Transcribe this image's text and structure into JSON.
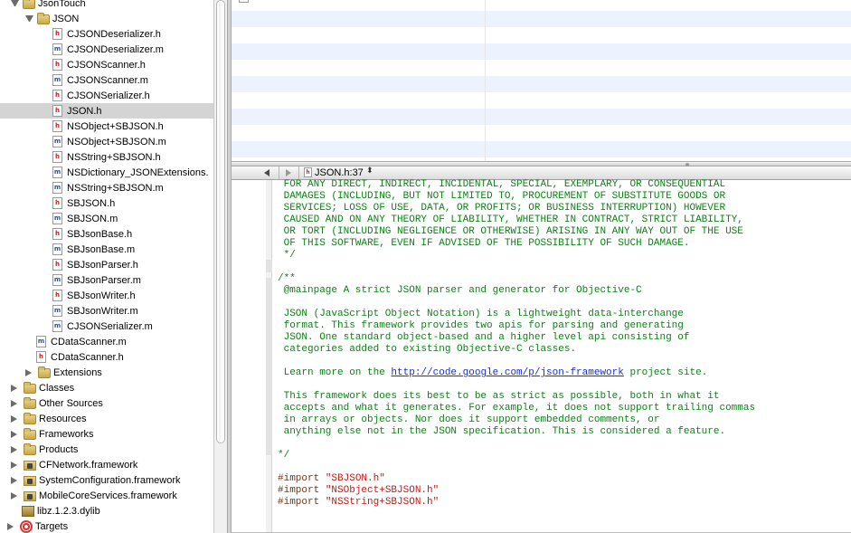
{
  "tree": {
    "rows": [
      {
        "label": "JsonTouch",
        "icon": "folder-icon",
        "disclosure": "open",
        "indent": 1
      },
      {
        "label": "JSON",
        "icon": "folder-icon",
        "disclosure": "open",
        "indent": 2
      },
      {
        "label": "CJSONDeserializer.h",
        "icon": "header-file-icon",
        "disclosure": "none",
        "indent": 3
      },
      {
        "label": "CJSONDeserializer.m",
        "icon": "source-file-icon",
        "disclosure": "none",
        "indent": 3
      },
      {
        "label": "CJSONScanner.h",
        "icon": "header-file-icon",
        "disclosure": "none",
        "indent": 3
      },
      {
        "label": "CJSONScanner.m",
        "icon": "source-file-icon",
        "disclosure": "none",
        "indent": 3
      },
      {
        "label": "CJSONSerializer.h",
        "icon": "header-file-icon",
        "disclosure": "none",
        "indent": 3
      },
      {
        "label": "JSON.h",
        "icon": "header-file-icon",
        "disclosure": "none",
        "indent": 3,
        "selected": true
      },
      {
        "label": "NSObject+SBJSON.h",
        "icon": "header-file-icon",
        "disclosure": "none",
        "indent": 3
      },
      {
        "label": "NSObject+SBJSON.m",
        "icon": "source-file-icon",
        "disclosure": "none",
        "indent": 3
      },
      {
        "label": "NSString+SBJSON.h",
        "icon": "header-file-icon",
        "disclosure": "none",
        "indent": 3
      },
      {
        "label": "NSDictionary_JSONExtensions.",
        "icon": "source-file-icon",
        "disclosure": "none",
        "indent": 3
      },
      {
        "label": "NSString+SBJSON.m",
        "icon": "source-file-icon",
        "disclosure": "none",
        "indent": 3
      },
      {
        "label": "SBJSON.h",
        "icon": "header-file-icon",
        "disclosure": "none",
        "indent": 3
      },
      {
        "label": "SBJSON.m",
        "icon": "source-file-icon",
        "disclosure": "none",
        "indent": 3
      },
      {
        "label": "SBJsonBase.h",
        "icon": "header-file-icon",
        "disclosure": "none",
        "indent": 3
      },
      {
        "label": "SBJsonBase.m",
        "icon": "source-file-icon",
        "disclosure": "none",
        "indent": 3
      },
      {
        "label": "SBJsonParser.h",
        "icon": "header-file-icon",
        "disclosure": "none",
        "indent": 3
      },
      {
        "label": "SBJsonParser.m",
        "icon": "source-file-icon",
        "disclosure": "none",
        "indent": 3
      },
      {
        "label": "SBJsonWriter.h",
        "icon": "header-file-icon",
        "disclosure": "none",
        "indent": 3
      },
      {
        "label": "SBJsonWriter.m",
        "icon": "source-file-icon",
        "disclosure": "none",
        "indent": 3
      },
      {
        "label": "CJSONSerializer.m",
        "icon": "source-file-icon",
        "disclosure": "none",
        "indent": 3
      },
      {
        "label": "CDataScanner.m",
        "icon": "source-file-icon",
        "disclosure": "none",
        "indent": 2
      },
      {
        "label": "CDataScanner.h",
        "icon": "header-file-icon",
        "disclosure": "none",
        "indent": 2
      },
      {
        "label": "Extensions",
        "icon": "folder-icon",
        "disclosure": "closed",
        "indent": 2
      },
      {
        "label": "Classes",
        "icon": "folder-icon",
        "disclosure": "closed",
        "indent": 1
      },
      {
        "label": "Other Sources",
        "icon": "folder-icon",
        "disclosure": "closed",
        "indent": 1
      },
      {
        "label": "Resources",
        "icon": "folder-icon",
        "disclosure": "closed",
        "indent": 1
      },
      {
        "label": "Frameworks",
        "icon": "folder-icon",
        "disclosure": "closed",
        "indent": 1
      },
      {
        "label": "Products",
        "icon": "folder-icon",
        "disclosure": "closed",
        "indent": 1
      },
      {
        "label": "CFNetwork.framework",
        "icon": "framework-icon",
        "disclosure": "closed",
        "indent": 1
      },
      {
        "label": "SystemConfiguration.framework",
        "icon": "framework-icon",
        "disclosure": "closed",
        "indent": 1
      },
      {
        "label": "MobileCoreServices.framework",
        "icon": "framework-icon",
        "disclosure": "closed",
        "indent": 1
      },
      {
        "label": "libz.1.2.3.dylib",
        "icon": "dylib-icon",
        "disclosure": "none",
        "indent": 1
      },
      {
        "label": "Targets",
        "icon": "target-icon",
        "disclosure": "closed",
        "indent": 0
      }
    ]
  },
  "detail": {
    "file_name": "JSON.h"
  },
  "navbar": {
    "file_label": "JSON.h:37",
    "popup_glyph": "⬍"
  },
  "editor": {
    "lines": [
      {
        "text": "FOR ANY DIRECT, INDIRECT, INCIDENTAL, SPECIAL, EXEMPLARY, OR CONSEQUENTIAL",
        "kind": "comment",
        "indent": 1
      },
      {
        "text": "DAMAGES (INCLUDING, BUT NOT LIMITED TO, PROCUREMENT OF SUBSTITUTE GOODS OR",
        "kind": "comment",
        "indent": 1
      },
      {
        "text": "SERVICES; LOSS OF USE, DATA, OR PROFITS; OR BUSINESS INTERRUPTION) HOWEVER",
        "kind": "comment",
        "indent": 1
      },
      {
        "text": "CAUSED AND ON ANY THEORY OF LIABILITY, WHETHER IN CONTRACT, STRICT LIABILITY,",
        "kind": "comment",
        "indent": 1
      },
      {
        "text": "OR TORT (INCLUDING NEGLIGENCE OR OTHERWISE) ARISING IN ANY WAY OUT OF THE USE",
        "kind": "comment",
        "indent": 1
      },
      {
        "text": "OF THIS SOFTWARE, EVEN IF ADVISED OF THE POSSIBILITY OF SUCH DAMAGE.",
        "kind": "comment",
        "indent": 1
      },
      {
        "text": "*/",
        "kind": "comment",
        "indent": 1
      },
      {
        "text": "",
        "kind": "blank",
        "indent": 0
      },
      {
        "text": "/**",
        "kind": "comment",
        "indent": 0
      },
      {
        "text": "@mainpage A strict JSON parser and generator for Objective-C",
        "kind": "comment",
        "indent": 1
      },
      {
        "text": "",
        "kind": "blank",
        "indent": 0
      },
      {
        "text": "JSON (JavaScript Object Notation) is a lightweight data-interchange",
        "kind": "comment",
        "indent": 1
      },
      {
        "text": "format. This framework provides two apis for parsing and generating",
        "kind": "comment",
        "indent": 1
      },
      {
        "text": "JSON. One standard object-based and a higher level api consisting of",
        "kind": "comment",
        "indent": 1
      },
      {
        "text": "categories added to existing Objective-C classes.",
        "kind": "comment",
        "indent": 1
      },
      {
        "text": "",
        "kind": "blank",
        "indent": 0
      },
      {
        "text": "Learn more on the ",
        "kind": "comment-link",
        "indent": 1,
        "link": "http://code.google.com/p/json-framework",
        "after": " project site."
      },
      {
        "text": "",
        "kind": "blank",
        "indent": 0
      },
      {
        "text": "This framework does its best to be as strict as possible, both in what it",
        "kind": "comment",
        "indent": 1
      },
      {
        "text": "accepts and what it generates. For example, it does not support trailing commas",
        "kind": "comment",
        "indent": 1
      },
      {
        "text": "in arrays or objects. Nor does it support embedded comments, or",
        "kind": "comment",
        "indent": 1
      },
      {
        "text": "anything else not in the JSON specification. This is considered a feature.",
        "kind": "comment",
        "indent": 1
      },
      {
        "text": "",
        "kind": "blank",
        "indent": 0
      },
      {
        "text": "*/",
        "kind": "comment",
        "indent": 0
      },
      {
        "text": "",
        "kind": "blank",
        "indent": 0
      },
      {
        "text": "#import ",
        "kind": "import",
        "indent": 0,
        "string": "\"SBJSON.h\""
      },
      {
        "text": "#import ",
        "kind": "import",
        "indent": 0,
        "string": "\"NSObject+SBJSON.h\""
      },
      {
        "text": "#import ",
        "kind": "import",
        "indent": 0,
        "string": "\"NSString+SBJSON.h\""
      }
    ]
  },
  "colors": {
    "comment": "#0f8018",
    "link": "#1a2fd1",
    "preprocessor": "#6b3a1d",
    "string": "#c41a16",
    "selection": "#d4d4d4",
    "alt_row": "#edf3fe"
  }
}
